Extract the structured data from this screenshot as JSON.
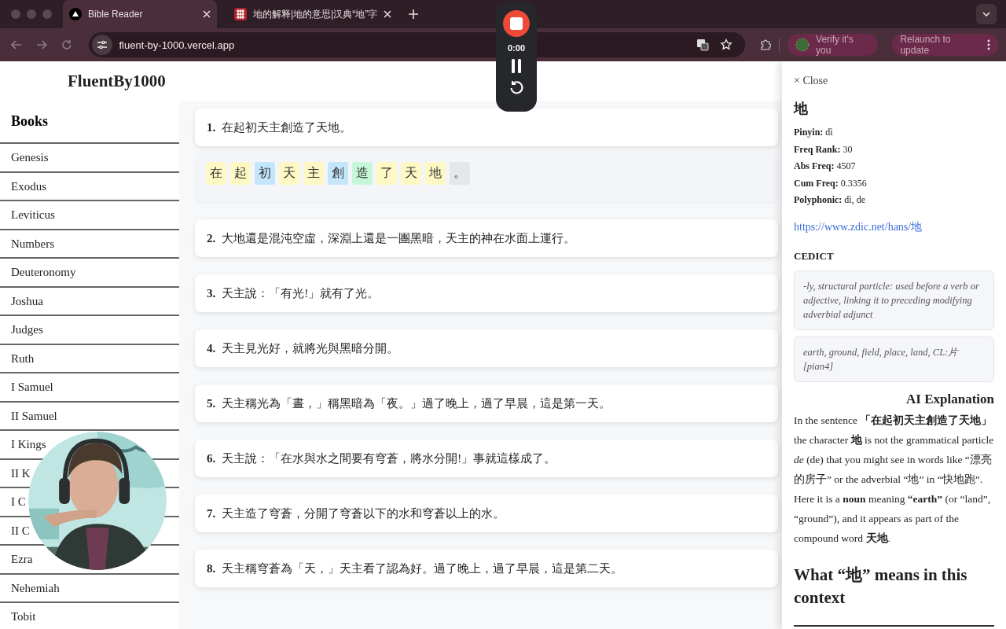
{
  "browser": {
    "tabs": [
      {
        "title": "Bible Reader",
        "selected": true
      },
      {
        "title": "地的解释|地的意思|汉典“地”字",
        "selected": false
      }
    ],
    "address": "fluent-by-1000.vercel.app",
    "verify": "Verify it's you",
    "relaunch": "Relaunch to update"
  },
  "recorder": {
    "time": "0:00"
  },
  "app": {
    "logo": "FluentBy1000"
  },
  "sidebar": {
    "title": "Books",
    "items": [
      "Genesis",
      "Exodus",
      "Leviticus",
      "Numbers",
      "Deuteronomy",
      "Joshua",
      "Judges",
      "Ruth",
      "I Samuel",
      "II Samuel",
      "I Kings",
      "II K",
      "I C",
      "II C",
      "Ezra",
      "Nehemiah",
      "Tobit"
    ]
  },
  "verses": [
    {
      "number": "1.",
      "text": "在起初天主創造了天地。",
      "tokens": [
        {
          "char": "在",
          "color": "#fdf8c4"
        },
        {
          "char": "起",
          "color": "#fdf8c4"
        },
        {
          "char": "初",
          "color": "#c4e6fb"
        },
        {
          "char": "天",
          "color": "#fdf8c4"
        },
        {
          "char": "主",
          "color": "#fdf8c4"
        },
        {
          "char": "創",
          "color": "#c4e6fb"
        },
        {
          "char": "造",
          "color": "#c6f7d9"
        },
        {
          "char": "了",
          "color": "#fdf8c4"
        },
        {
          "char": "天",
          "color": "#fdf8c4"
        },
        {
          "char": "地",
          "color": "#fdf8c4"
        },
        {
          "char": "。",
          "color": "#e5e7eb"
        }
      ]
    },
    {
      "number": "2.",
      "text": "大地還是混沌空虛，深淵上還是一團黑暗，天主的神在水面上運行。"
    },
    {
      "number": "3.",
      "text": "天主說：「有光!」就有了光。"
    },
    {
      "number": "4.",
      "text": "天主見光好，就將光與黑暗分開。"
    },
    {
      "number": "5.",
      "text": "天主稱光為「晝，」稱黑暗為「夜。」過了晚上，過了早晨，這是第一天。"
    },
    {
      "number": "6.",
      "text": "天主說：「在水與水之間要有穹蒼，將水分開!」事就這樣成了。"
    },
    {
      "number": "7.",
      "text": "天主造了穹蒼，分開了穹蒼以下的水和穹蒼以上的水。"
    },
    {
      "number": "8.",
      "text": "天主稱穹蒼為「天，」天主看了認為好。過了晚上，過了早晨，這是第二天。"
    }
  ],
  "panel": {
    "close": "× Close",
    "character": "地",
    "fields": [
      {
        "label": "Pinyin:",
        "value": "dì"
      },
      {
        "label": "Freq Rank:",
        "value": "30"
      },
      {
        "label": "Abs Freq:",
        "value": "4507"
      },
      {
        "label": "Cum Freq:",
        "value": "0.3356"
      },
      {
        "label": "Polyphonic:",
        "value": "dì, de"
      }
    ],
    "link": "https://www.zdic.net/hans/地",
    "cedict_title": "CEDICT",
    "definitions": [
      "-ly, structural particle: used before a verb or adjective, linking it to preceding modifying adverbial adjunct",
      "earth, ground, field, place, land, CL:片[pian4]"
    ],
    "ai_title": "AI Explanation",
    "ai_text": "In the sentence **「在起初天主創造了天地」** the character **地** is not the grammatical particle *de* (de) that you might see in words like “漂亮的房子” or the adverbial “地” in “快地跑”. Here it is a **noun** meaning **“earth”** (or “land”, “ground”), and it appears as part of the compound word **天地**.",
    "subheading": "What “地” means in this context"
  }
}
